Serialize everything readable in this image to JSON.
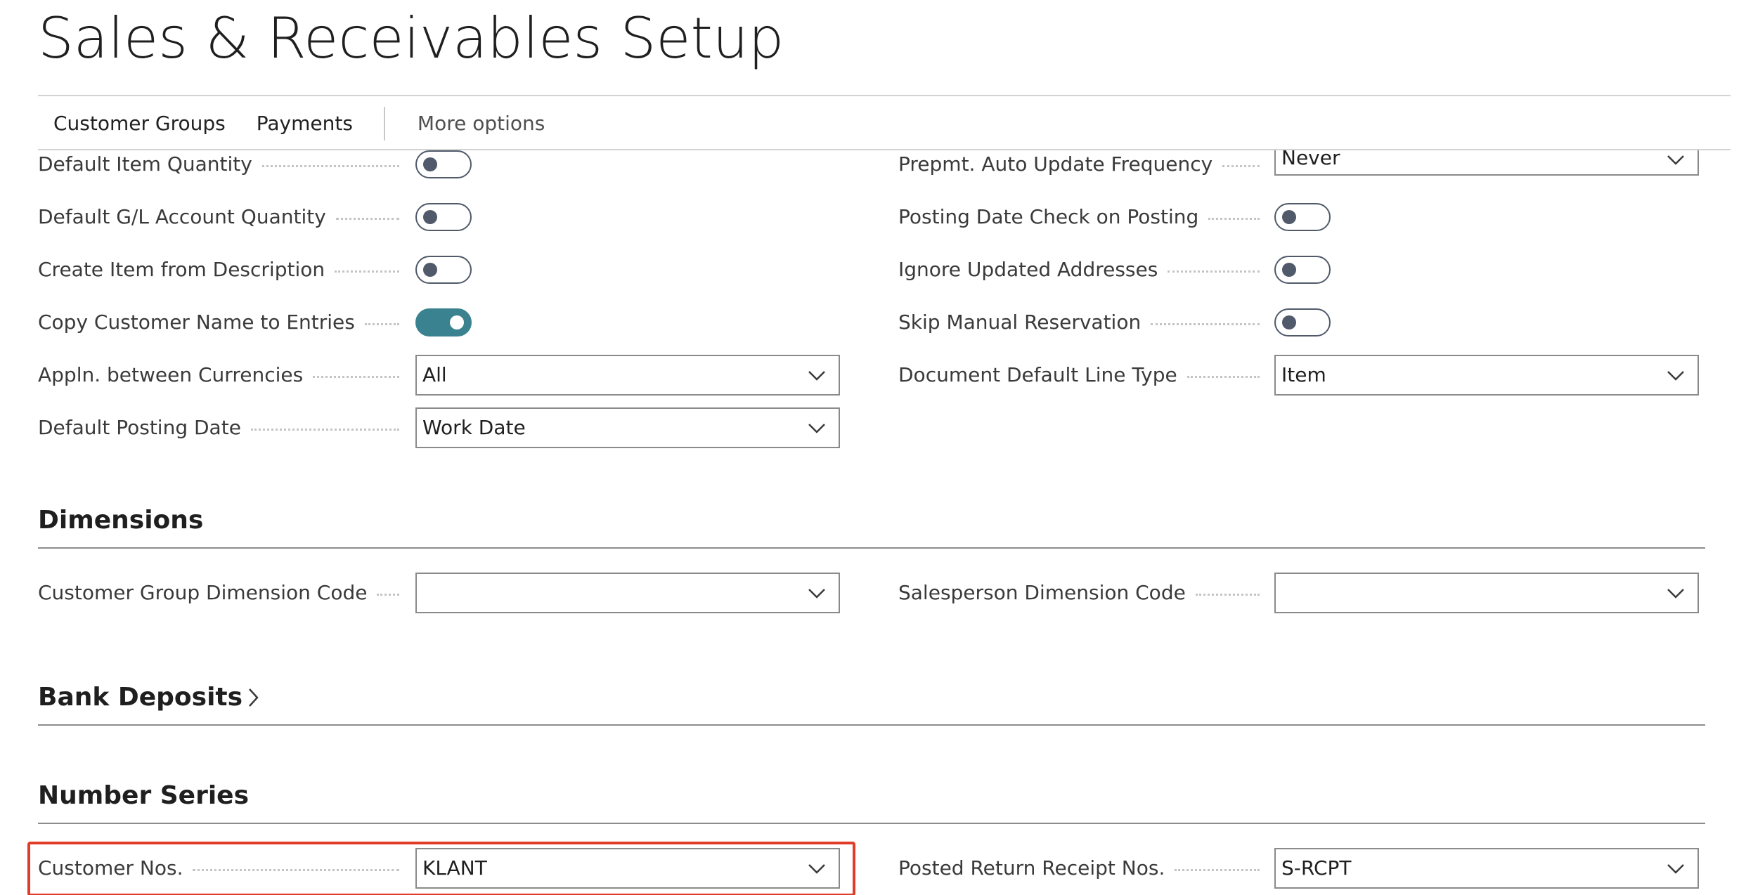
{
  "page": {
    "title": "Sales & Receivables Setup"
  },
  "actions": {
    "customer_groups": "Customer Groups",
    "payments": "Payments",
    "more_options": "More options"
  },
  "general": {
    "default_item_quantity": {
      "label": "Default Item Quantity",
      "on": false
    },
    "default_gl_account_quantity": {
      "label": "Default G/L Account Quantity",
      "on": false
    },
    "create_item_from_description": {
      "label": "Create Item from Description",
      "on": false
    },
    "copy_customer_name_to_entries": {
      "label": "Copy Customer Name to Entries",
      "on": true
    },
    "appln_between_currencies": {
      "label": "Appln. between Currencies",
      "value": "All"
    },
    "default_posting_date": {
      "label": "Default Posting Date",
      "value": "Work Date"
    },
    "prepmt_auto_update_frequency": {
      "label": "Prepmt. Auto Update Frequency",
      "value": "Never"
    },
    "posting_date_check_on_posting": {
      "label": "Posting Date Check on Posting",
      "on": false
    },
    "ignore_updated_addresses": {
      "label": "Ignore Updated Addresses",
      "on": false
    },
    "skip_manual_reservation": {
      "label": "Skip Manual Reservation",
      "on": false
    },
    "document_default_line_type": {
      "label": "Document Default Line Type",
      "value": "Item"
    }
  },
  "dimensions": {
    "title": "Dimensions",
    "customer_group_dimension_code": {
      "label": "Customer Group Dimension Code",
      "value": ""
    },
    "salesperson_dimension_code": {
      "label": "Salesperson Dimension Code",
      "value": ""
    }
  },
  "bank_deposits": {
    "title": "Bank Deposits"
  },
  "number_series": {
    "title": "Number Series",
    "customer_nos": {
      "label": "Customer Nos.",
      "value": "KLANT"
    },
    "posted_return_receipt_nos": {
      "label": "Posted Return Receipt Nos.",
      "value": "S-RCPT"
    }
  },
  "colors": {
    "toggle_on": "#3b8290",
    "toggle_off": "#505a6a",
    "highlight": "#e03c28"
  },
  "icons": {
    "dropdown": "chevron-down-icon",
    "expand": "chevron-right-icon"
  }
}
